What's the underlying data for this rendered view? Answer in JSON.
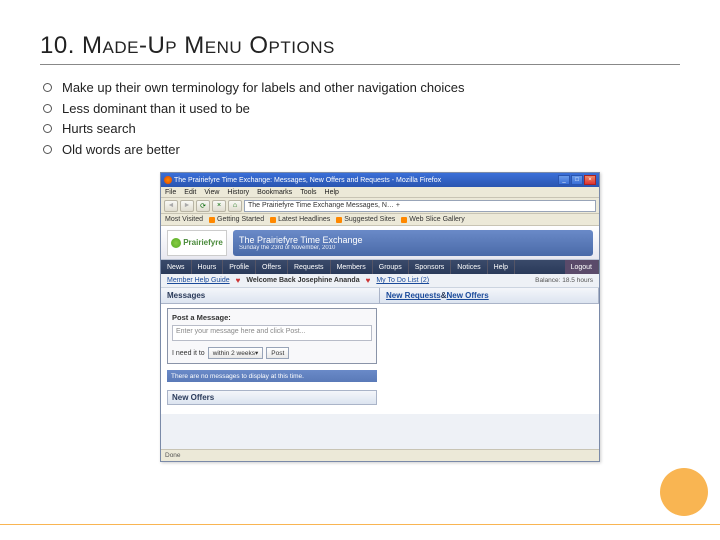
{
  "title": "10. Made-Up Menu Options",
  "bullets": [
    "Make up their own terminology for labels and other navigation choices",
    "Less dominant than it used to be",
    "Hurts search",
    "Old words are better"
  ],
  "browser": {
    "window_title": "The Prairiefyre Time Exchange: Messages, New Offers and Requests - Mozilla Firefox",
    "menu": [
      "File",
      "Edit",
      "View",
      "History",
      "Bookmarks",
      "Tools",
      "Help"
    ],
    "url": "The Prairiefyre Time Exchange Messages, N…  +",
    "bookmarks_label": "Most Visited",
    "bookmarks": [
      "Getting Started",
      "Latest Headlines",
      "Suggested Sites",
      "Web Slice Gallery"
    ],
    "logo": "Prairiefyre",
    "header_title": "The Prairiefyre Time Exchange",
    "header_sub": "Sunday the 23rd of November, 2010",
    "nav": [
      "News",
      "Hours",
      "Profile",
      "Offers",
      "Requests",
      "Members",
      "Groups",
      "Sponsors",
      "Notices",
      "Help"
    ],
    "nav_logout": "Logout",
    "subbar": {
      "guide": "Member Help Guide",
      "welcome": "Welcome Back Josephine Ananda",
      "todo": "My To Do List (2)",
      "balance": "Balance: 18.5 hours"
    },
    "col_left": "Messages",
    "col_right_a": "New Requests",
    "col_right_amp": " & ",
    "col_right_b": "New Offers",
    "post_header": "Post a Message:",
    "post_placeholder": "Enter your message here and click Post...",
    "need_label": "I need it to",
    "need_select": "within 2 weeks",
    "post_btn": "Post",
    "no_items": "There are no messages to display at this time.",
    "new_offers_hdr": "New Offers",
    "status": "Done"
  }
}
